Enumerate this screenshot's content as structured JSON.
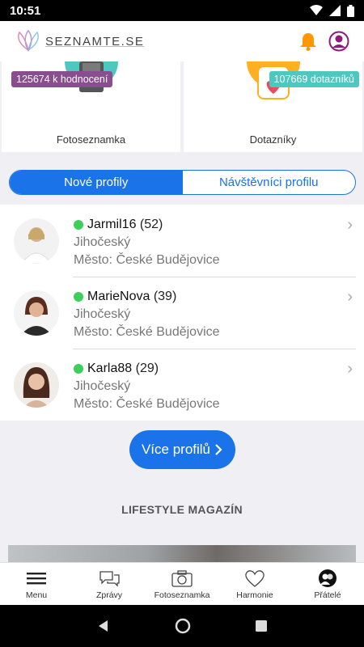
{
  "status": {
    "time": "10:51"
  },
  "app": {
    "brand": "SEZNAMTE.SE"
  },
  "tiles": [
    {
      "badge": "125674 k hodnocení",
      "label": "Fotoseznamka"
    },
    {
      "badge": "107669 dotazníků",
      "label": "Dotazníky"
    }
  ],
  "segment": {
    "active": "Nové profily",
    "inactive": "Návštěvníci profilu"
  },
  "profiles": [
    {
      "name": "Jarmil16",
      "age": "(52)",
      "region": "Jihočeský",
      "city": "Město: České Budějovice"
    },
    {
      "name": "MarieNova",
      "age": "(39)",
      "region": "Jihočeský",
      "city": "Město: České Budějovice"
    },
    {
      "name": "Karla88",
      "age": "(29)",
      "region": "Jihočeský",
      "city": "Město: České Budějovice"
    }
  ],
  "more_button": "Více profilů",
  "magazine_title": "LIFESTYLE MAGAZÍN",
  "tabs": [
    {
      "label": "Menu",
      "icon": "menu-icon"
    },
    {
      "label": "Zprávy",
      "icon": "chat-icon"
    },
    {
      "label": "Fotoseznamka",
      "icon": "camera-icon"
    },
    {
      "label": "Harmonie",
      "icon": "heart-icon"
    },
    {
      "label": "Přátelé",
      "icon": "friends-icon"
    }
  ],
  "colors": {
    "accent": "#1a73e8",
    "online": "#3ccf5a",
    "bell": "#ff9800",
    "badge_purple": "#8a4d8f",
    "badge_teal": "#4cc8c0"
  }
}
